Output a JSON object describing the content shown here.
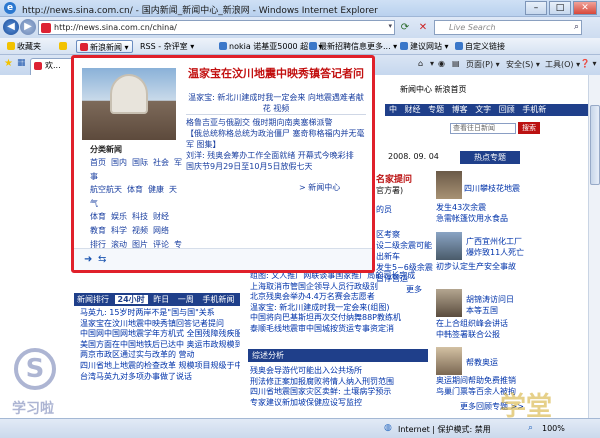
{
  "window": {
    "title": "http://news.sina.com.cn/ - 国内新闻_新闻中心_新浪网 - Windows Internet Explorer",
    "min": "–",
    "max": "□",
    "close": "✕"
  },
  "address": {
    "url": "http://news.sina.com.cn/china/",
    "search_placeholder": "Live Search"
  },
  "favbar": {
    "favorites": "收藏夹",
    "items": [
      "新浪新闻 ▾",
      "RSS - 杂评室 ▾",
      "nokia 诺基亚5000 超... ▾",
      "最新招聘信息更多... ▾",
      "建议网站 ▾",
      "自定义链接"
    ]
  },
  "tabbar": {
    "tab": "欢...",
    "tools": [
      "主页",
      "▾",
      "页面(P) ▾",
      "安全(S) ▾",
      "工具(O) ▾",
      "❓ ▾"
    ]
  },
  "page": {
    "top_links": "新闻中心   新浪首页",
    "nav": [
      "中",
      "财经",
      "专题",
      "博客",
      "文字",
      "回顾",
      "手机新"
    ],
    "search_box": "查看往日新闻",
    "search_btn": "搜索",
    "date": "2008. 09. 04",
    "hot": "热点专题",
    "right_news": [
      "四川攀枝花地震",
      "发生43次余震",
      "急需帐篷饮用水食品",
      "广西宜州化工厂",
      "爆炸致11人死亡",
      "初步认定生产安全事故",
      "胡锦涛访问日",
      "本等五国",
      "在上合组织峰会讲话",
      "中韩签署联合公报",
      "帮教奥运",
      "奥运期间帮助免费推销",
      "鸟巢门票等百余人被拘",
      "更多回顾专题 >>"
    ],
    "mid_snippets": [
      "名家提问",
      "官方署)",
      "的员",
      "区考察",
      "设二级余震可能",
      "出新车",
      "发生5~6级余震",
      "暂停营运",
      "更多"
    ],
    "headlines_label": "排行",
    "list_top": [
      "组图: 文人推广网联谈事国家推广局的司长完成",
      "上海取消市管国企领导人员行政级别",
      "北京残奥会举办4.4万名赛会志愿者",
      "温家宝: 新北川建成时我一定会来(组图)",
      "中国将向巴基斯坦再次交付纳舞88P教练机",
      "泰顺毛线地震审中国城按货运专事资定消"
    ],
    "rank_tabs": [
      "新闻排行",
      "24小时",
      "昨日",
      "一周",
      "手机新闻"
    ],
    "rank_list": [
      "马英九: 15岁时两岸不是\"国与国\"关系",
      "温家宝在汶川地震中映秀镇回答记者提问",
      "中国网中国网地震学年方机式 全国残障残疾服务",
      "美国方面在中国地铁后已达中 奥运市政规模到",
      "两京市政区通过实与改革的 营动",
      "四川省地上地震的检查改革 规模项目规级于中",
      "台湾马英九对多项办事做了说话"
    ],
    "analysis_title": "综述分析",
    "analysis_list": [
      "残奥会导游代可能出入公共场所",
      "刑法修正案加报腐败将情人纳入刑罚范围",
      "四川省地震国家灾区卖鲜: 土壤病学预示",
      "专家建议新加坡保健应设写监控"
    ]
  },
  "popup": {
    "headline": "温家宝在汶川地震中映秀镇答记者问",
    "sub": "温家宝: 新北川建成时我一定会来  向地震遇难者献花  视频",
    "news": [
      "格鲁吉亚与俄副交  俄时期向南奥塞梯派警",
      "【俄总统称格总统为政治僵尸  塞奇称格福内并无毫军  图集】",
      "刘洋: 残奥会筹办工作全面就绪  开幕式今晚彩排",
      "国庆节9月29日至10月5日放假七天"
    ],
    "cat_title": "分类新闻",
    "cats": [
      [
        "首页",
        "国内",
        "国际",
        "社会",
        "军事"
      ],
      [
        "航空航天",
        "体育",
        "健康",
        "天气"
      ],
      [
        "体育",
        "娱乐",
        "科技",
        "财经"
      ],
      [
        "教育",
        "科学",
        "视频",
        "网络"
      ],
      [
        "排行",
        "滚动",
        "图片",
        "评论",
        "专题"
      ]
    ],
    "more": "> 新闻中心"
  },
  "status": {
    "text": "Internet | 保护模式: 禁用",
    "zoom": "100%"
  },
  "watermark": {
    "left": "S",
    "left_text": "学习啦",
    "right": "学堂"
  }
}
